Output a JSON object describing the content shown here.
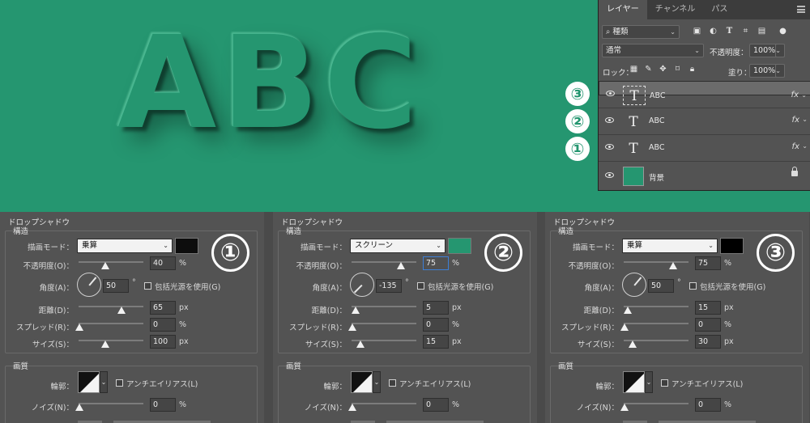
{
  "layers_panel": {
    "tabs": [
      "レイヤー",
      "チャンネル",
      "パス"
    ],
    "filter_kind": "種類",
    "blend_mode": "通常",
    "opacity_label": "不透明度：",
    "opacity_value": "100%",
    "lock_label": "ロック：",
    "fill_label": "塗り：",
    "fill_value": "100%",
    "layers": [
      {
        "name": "ABC",
        "kind": "text",
        "fx": "fx",
        "marker": "③"
      },
      {
        "name": "ABC",
        "kind": "text",
        "fx": "fx",
        "marker": "②"
      },
      {
        "name": "ABC",
        "kind": "text",
        "fx": "fx",
        "marker": "①"
      },
      {
        "name": "背景",
        "kind": "background"
      }
    ]
  },
  "canvas": {
    "text": "ABC",
    "color": "#259670"
  },
  "labels": {
    "title": "ドロップシャドウ",
    "structure": "構造",
    "blend": "描画モード：",
    "opacity": "不透明度(O)：",
    "angle": "角度(A)：",
    "global_light": "包括光源を使用(G)",
    "distance": "距離(D)：",
    "spread": "スプレッド(R)：",
    "size": "サイズ(S)：",
    "quality": "画質",
    "contour": "輪郭：",
    "antialias": "アンチエイリアス(L)",
    "noise": "ノイズ(N)："
  },
  "dialogs": [
    {
      "marker": "①",
      "blend_mode": "乗算",
      "color": "#0d0d0d",
      "opacity": "40",
      "opacity_pct": 0.4,
      "angle": "50",
      "angle_deg": 50,
      "distance": "65",
      "distance_frac": 0.65,
      "spread": "0",
      "spread_frac": 0.0,
      "size": "100",
      "size_frac": 0.4,
      "noise": "0",
      "units": {
        "opacity": "%",
        "angle": "°",
        "distance": "px",
        "spread": "%",
        "size": "px",
        "noise": "%"
      }
    },
    {
      "marker": "②",
      "blend_mode": "スクリーン",
      "color": "#259670",
      "opacity": "75",
      "opacity_pct": 0.75,
      "angle": "-135",
      "angle_deg": -135,
      "distance": "5",
      "distance_frac": 0.05,
      "spread": "0",
      "spread_frac": 0.0,
      "size": "15",
      "size_frac": 0.12,
      "noise": "0",
      "units": {
        "opacity": "%",
        "angle": "°",
        "distance": "px",
        "spread": "%",
        "size": "px",
        "noise": "%"
      }
    },
    {
      "marker": "③",
      "blend_mode": "乗算",
      "color": "#000000",
      "opacity": "75",
      "opacity_pct": 0.75,
      "angle": "50",
      "angle_deg": 50,
      "distance": "15",
      "distance_frac": 0.05,
      "spread": "0",
      "spread_frac": 0.0,
      "size": "30",
      "size_frac": 0.12,
      "noise": "0",
      "units": {
        "opacity": "%",
        "angle": "°",
        "distance": "px",
        "spread": "%",
        "size": "px",
        "noise": "%"
      }
    }
  ]
}
